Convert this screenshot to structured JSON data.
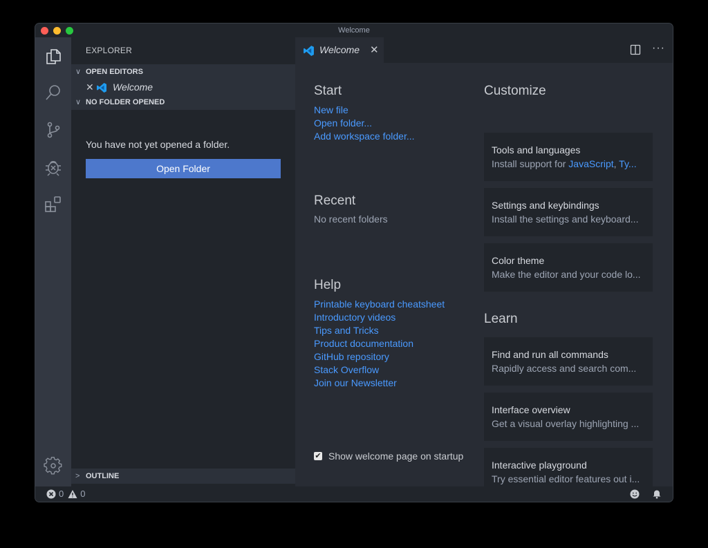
{
  "window": {
    "title": "Welcome"
  },
  "activity_bar": {
    "items": [
      {
        "name": "explorer",
        "icon": "files-icon"
      },
      {
        "name": "search",
        "icon": "search-icon"
      },
      {
        "name": "source-control",
        "icon": "source-control-icon"
      },
      {
        "name": "debug",
        "icon": "debug-icon"
      },
      {
        "name": "extensions",
        "icon": "extensions-icon"
      }
    ],
    "bottom": {
      "name": "manage",
      "icon": "gear-icon"
    }
  },
  "sidebar": {
    "title": "EXPLORER",
    "sections": {
      "open_editors": "OPEN EDITORS",
      "no_folder": "NO FOLDER OPENED",
      "outline": "OUTLINE"
    },
    "open_editors": [
      {
        "label": "Welcome"
      }
    ],
    "no_folder_message": "You have not yet opened a folder.",
    "open_folder_button": "Open Folder"
  },
  "tabs": [
    {
      "label": "Welcome",
      "active": true
    }
  ],
  "welcome": {
    "start": {
      "heading": "Start",
      "links": [
        "New file",
        "Open folder...",
        "Add workspace folder..."
      ]
    },
    "recent": {
      "heading": "Recent",
      "empty": "No recent folders"
    },
    "help": {
      "heading": "Help",
      "links": [
        "Printable keyboard cheatsheet",
        "Introductory videos",
        "Tips and Tricks",
        "Product documentation",
        "GitHub repository",
        "Stack Overflow",
        "Join our Newsletter"
      ]
    },
    "show_on_startup": {
      "label": "Show welcome page on startup",
      "checked": true
    },
    "customize": {
      "heading": "Customize",
      "cards": [
        {
          "title": "Tools and languages",
          "desc_prefix": "Install support for ",
          "desc_link1": "JavaScript",
          "desc_sep": ", ",
          "desc_link2": "Ty..."
        },
        {
          "title": "Settings and keybindings",
          "desc": "Install the settings and keyboard..."
        },
        {
          "title": "Color theme",
          "desc": "Make the editor and your code lo..."
        }
      ]
    },
    "learn": {
      "heading": "Learn",
      "cards": [
        {
          "title": "Find and run all commands",
          "desc": "Rapidly access and search com..."
        },
        {
          "title": "Interface overview",
          "desc": "Get a visual overlay highlighting ..."
        },
        {
          "title": "Interactive playground",
          "desc": "Try essential editor features out i..."
        }
      ]
    }
  },
  "status_bar": {
    "errors": "0",
    "warnings": "0"
  },
  "colors": {
    "accent": "#4d78cc",
    "link": "#4a9aff",
    "editor_bg": "#282c34",
    "sidebar_bg": "#21252b",
    "activity_bg": "#333842"
  }
}
